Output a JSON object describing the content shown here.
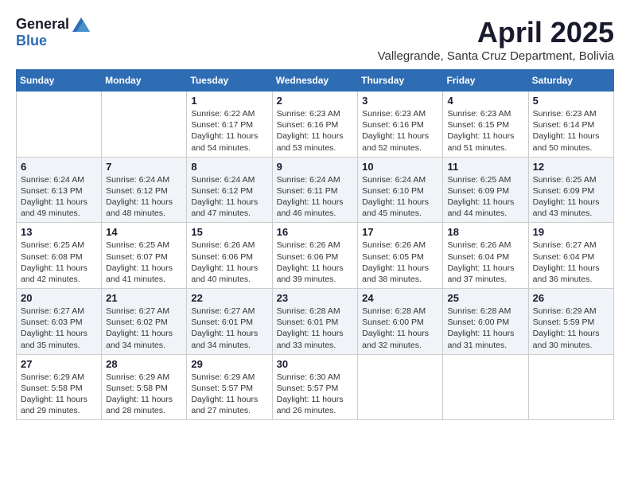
{
  "logo": {
    "general": "General",
    "blue": "Blue"
  },
  "title": {
    "month": "April 2025",
    "location": "Vallegrande, Santa Cruz Department, Bolivia"
  },
  "weekdays": [
    "Sunday",
    "Monday",
    "Tuesday",
    "Wednesday",
    "Thursday",
    "Friday",
    "Saturday"
  ],
  "weeks": [
    [
      {
        "day": "",
        "info": ""
      },
      {
        "day": "",
        "info": ""
      },
      {
        "day": "1",
        "info": "Sunrise: 6:22 AM\nSunset: 6:17 PM\nDaylight: 11 hours and 54 minutes."
      },
      {
        "day": "2",
        "info": "Sunrise: 6:23 AM\nSunset: 6:16 PM\nDaylight: 11 hours and 53 minutes."
      },
      {
        "day": "3",
        "info": "Sunrise: 6:23 AM\nSunset: 6:16 PM\nDaylight: 11 hours and 52 minutes."
      },
      {
        "day": "4",
        "info": "Sunrise: 6:23 AM\nSunset: 6:15 PM\nDaylight: 11 hours and 51 minutes."
      },
      {
        "day": "5",
        "info": "Sunrise: 6:23 AM\nSunset: 6:14 PM\nDaylight: 11 hours and 50 minutes."
      }
    ],
    [
      {
        "day": "6",
        "info": "Sunrise: 6:24 AM\nSunset: 6:13 PM\nDaylight: 11 hours and 49 minutes."
      },
      {
        "day": "7",
        "info": "Sunrise: 6:24 AM\nSunset: 6:12 PM\nDaylight: 11 hours and 48 minutes."
      },
      {
        "day": "8",
        "info": "Sunrise: 6:24 AM\nSunset: 6:12 PM\nDaylight: 11 hours and 47 minutes."
      },
      {
        "day": "9",
        "info": "Sunrise: 6:24 AM\nSunset: 6:11 PM\nDaylight: 11 hours and 46 minutes."
      },
      {
        "day": "10",
        "info": "Sunrise: 6:24 AM\nSunset: 6:10 PM\nDaylight: 11 hours and 45 minutes."
      },
      {
        "day": "11",
        "info": "Sunrise: 6:25 AM\nSunset: 6:09 PM\nDaylight: 11 hours and 44 minutes."
      },
      {
        "day": "12",
        "info": "Sunrise: 6:25 AM\nSunset: 6:09 PM\nDaylight: 11 hours and 43 minutes."
      }
    ],
    [
      {
        "day": "13",
        "info": "Sunrise: 6:25 AM\nSunset: 6:08 PM\nDaylight: 11 hours and 42 minutes."
      },
      {
        "day": "14",
        "info": "Sunrise: 6:25 AM\nSunset: 6:07 PM\nDaylight: 11 hours and 41 minutes."
      },
      {
        "day": "15",
        "info": "Sunrise: 6:26 AM\nSunset: 6:06 PM\nDaylight: 11 hours and 40 minutes."
      },
      {
        "day": "16",
        "info": "Sunrise: 6:26 AM\nSunset: 6:06 PM\nDaylight: 11 hours and 39 minutes."
      },
      {
        "day": "17",
        "info": "Sunrise: 6:26 AM\nSunset: 6:05 PM\nDaylight: 11 hours and 38 minutes."
      },
      {
        "day": "18",
        "info": "Sunrise: 6:26 AM\nSunset: 6:04 PM\nDaylight: 11 hours and 37 minutes."
      },
      {
        "day": "19",
        "info": "Sunrise: 6:27 AM\nSunset: 6:04 PM\nDaylight: 11 hours and 36 minutes."
      }
    ],
    [
      {
        "day": "20",
        "info": "Sunrise: 6:27 AM\nSunset: 6:03 PM\nDaylight: 11 hours and 35 minutes."
      },
      {
        "day": "21",
        "info": "Sunrise: 6:27 AM\nSunset: 6:02 PM\nDaylight: 11 hours and 34 minutes."
      },
      {
        "day": "22",
        "info": "Sunrise: 6:27 AM\nSunset: 6:01 PM\nDaylight: 11 hours and 34 minutes."
      },
      {
        "day": "23",
        "info": "Sunrise: 6:28 AM\nSunset: 6:01 PM\nDaylight: 11 hours and 33 minutes."
      },
      {
        "day": "24",
        "info": "Sunrise: 6:28 AM\nSunset: 6:00 PM\nDaylight: 11 hours and 32 minutes."
      },
      {
        "day": "25",
        "info": "Sunrise: 6:28 AM\nSunset: 6:00 PM\nDaylight: 11 hours and 31 minutes."
      },
      {
        "day": "26",
        "info": "Sunrise: 6:29 AM\nSunset: 5:59 PM\nDaylight: 11 hours and 30 minutes."
      }
    ],
    [
      {
        "day": "27",
        "info": "Sunrise: 6:29 AM\nSunset: 5:58 PM\nDaylight: 11 hours and 29 minutes."
      },
      {
        "day": "28",
        "info": "Sunrise: 6:29 AM\nSunset: 5:58 PM\nDaylight: 11 hours and 28 minutes."
      },
      {
        "day": "29",
        "info": "Sunrise: 6:29 AM\nSunset: 5:57 PM\nDaylight: 11 hours and 27 minutes."
      },
      {
        "day": "30",
        "info": "Sunrise: 6:30 AM\nSunset: 5:57 PM\nDaylight: 11 hours and 26 minutes."
      },
      {
        "day": "",
        "info": ""
      },
      {
        "day": "",
        "info": ""
      },
      {
        "day": "",
        "info": ""
      }
    ]
  ]
}
